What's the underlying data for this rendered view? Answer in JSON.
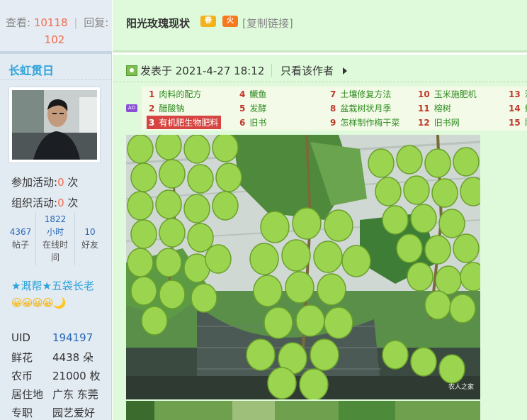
{
  "stats": {
    "view_label": "查看:",
    "views": "10118",
    "reply_label": "回复:",
    "replies": "102"
  },
  "user": {
    "name": "长虹贯日",
    "join_label": "参加活动:",
    "join_count": "0",
    "join_unit": "次",
    "org_label": "组织活动:",
    "org_count": "0",
    "org_unit": "次",
    "posts_value": "4367",
    "posts_label": "帖子",
    "online_value": "1822 小时",
    "online_label": "在线时间",
    "friends_value": "10",
    "friends_label": "好友",
    "rank": "★溉帮★五袋长老",
    "emoticons": "😀😀😀😀🌙",
    "uid_label": "UID",
    "uid": "194197",
    "flowers_label": "鲜花",
    "flowers": "4438 朵",
    "coins_label": "农币",
    "coins": "21000 枚",
    "location_label": "居住地",
    "location": "广东 东莞",
    "job_label": "专职",
    "job": "园艺爱好"
  },
  "thread": {
    "title": "阳光玫瑰现状",
    "badge_spring": "春",
    "badge_fire": "火",
    "copy_link": "[复制链接]",
    "posted": "发表于 2021-4-27 18:12",
    "only_author": "只看该作者"
  },
  "keywords": {
    "ad": "AD",
    "items": [
      {
        "n": "1",
        "t": "肉料的配方"
      },
      {
        "n": "2",
        "t": "醋酸钠"
      },
      {
        "n": "3",
        "t": "有机肥生物肥料"
      },
      {
        "n": "4",
        "t": "鳜鱼"
      },
      {
        "n": "5",
        "t": "发酵"
      },
      {
        "n": "6",
        "t": "旧书"
      },
      {
        "n": "7",
        "t": "土壤修复方法"
      },
      {
        "n": "8",
        "t": "盆栽树状月季"
      },
      {
        "n": "9",
        "t": "怎样制作梅干菜"
      },
      {
        "n": "10",
        "t": "玉米施肥机"
      },
      {
        "n": "11",
        "t": "榕树"
      },
      {
        "n": "12",
        "t": "旧书网"
      },
      {
        "n": "13",
        "t": "沙"
      },
      {
        "n": "14",
        "t": "蚯"
      },
      {
        "n": "15",
        "t": "阳"
      }
    ]
  },
  "photo": {
    "watermark": "农人之家"
  }
}
